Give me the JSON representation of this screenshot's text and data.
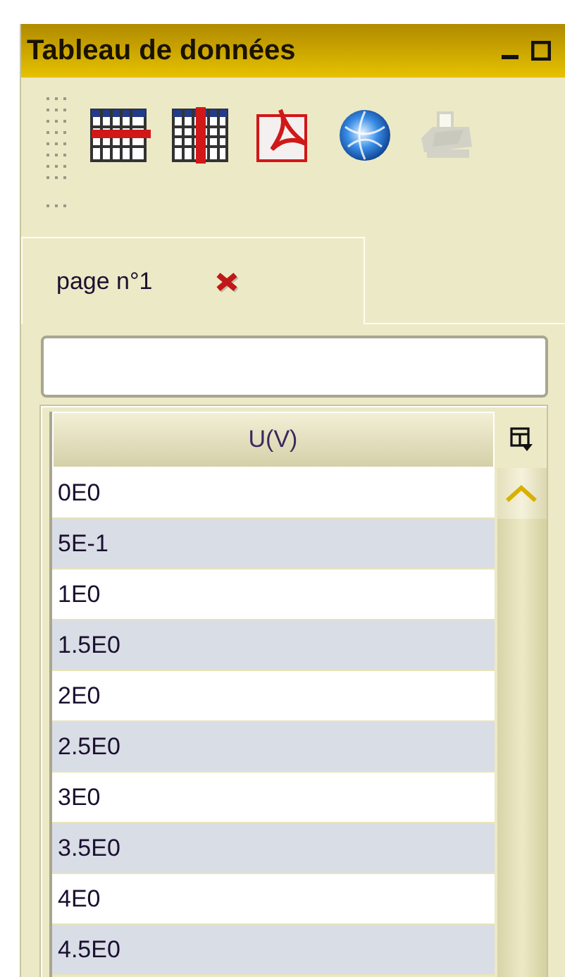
{
  "window": {
    "title": "Tableau de données"
  },
  "toolbar": [
    {
      "kind": "rows",
      "disabled": false
    },
    {
      "kind": "columns",
      "disabled": false
    },
    {
      "kind": "pdf",
      "disabled": false
    },
    {
      "kind": "globe",
      "disabled": false
    },
    {
      "kind": "printer",
      "disabled": true
    }
  ],
  "tabs": [
    {
      "label": "page n°1",
      "selected": true
    }
  ],
  "table": {
    "columns": [
      "U(V)"
    ],
    "rows": [
      [
        "0E0"
      ],
      [
        "5E-1"
      ],
      [
        "1E0"
      ],
      [
        "1.5E0"
      ],
      [
        "2E0"
      ],
      [
        "2.5E0"
      ],
      [
        "3E0"
      ],
      [
        "3.5E0"
      ],
      [
        "4E0"
      ],
      [
        "4.5E0"
      ]
    ]
  }
}
